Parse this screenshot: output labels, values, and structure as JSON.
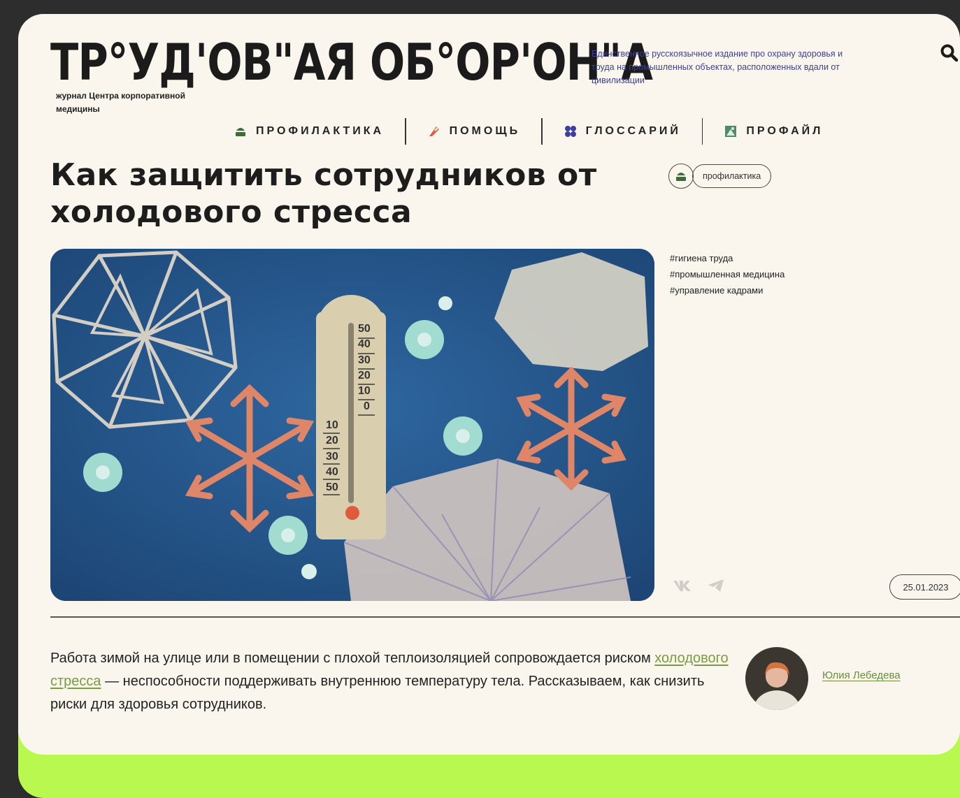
{
  "header": {
    "logo": "ТР°УД'ОВ\"АЯ ОБ°ОР'ОН\"А",
    "tagline": "Единственное русскоязычное издание про охрану здоровья и труда на промышленных объектах, расположенных вдали от цивилизации",
    "subtitle": "журнал Центра корпоративной медицины"
  },
  "nav": {
    "items": [
      {
        "label": "ПРОФИЛАКТИКА",
        "icon": "prophylaxis-icon"
      },
      {
        "label": "ПОМОЩЬ",
        "icon": "help-icon"
      },
      {
        "label": "ГЛОССАРИЙ",
        "icon": "glossary-icon"
      },
      {
        "label": "ПРОФАЙЛ",
        "icon": "profile-icon"
      }
    ]
  },
  "article": {
    "title": "Как защитить сотрудников от холодового стресса",
    "category": "профилактика",
    "tags": [
      "#гигиена труда",
      "#промышленная медицина",
      "#управление кадрами"
    ],
    "date": "25.01.2023",
    "lead_before": "Работа зимой на улице или в помещении с плохой теплоизоляцией сопровождается риском ",
    "lead_link": "холодового стресса",
    "lead_after": " — неспособности поддерживать внутреннюю температуру тела. Рассказываем, как снизить риски для здоровья сотрудников.",
    "author": "Юлия Лебедева",
    "thermometer_scale_top": [
      "50",
      "40",
      "30",
      "20",
      "10",
      "0"
    ],
    "thermometer_scale_bottom": [
      "10",
      "20",
      "30",
      "40",
      "50"
    ]
  },
  "colors": {
    "background": "#2d2d2d",
    "card": "#faf6ee",
    "accent_lime": "#b8f84f",
    "tagline_blue": "#3c3f9c",
    "link_green": "#7a9b42"
  }
}
